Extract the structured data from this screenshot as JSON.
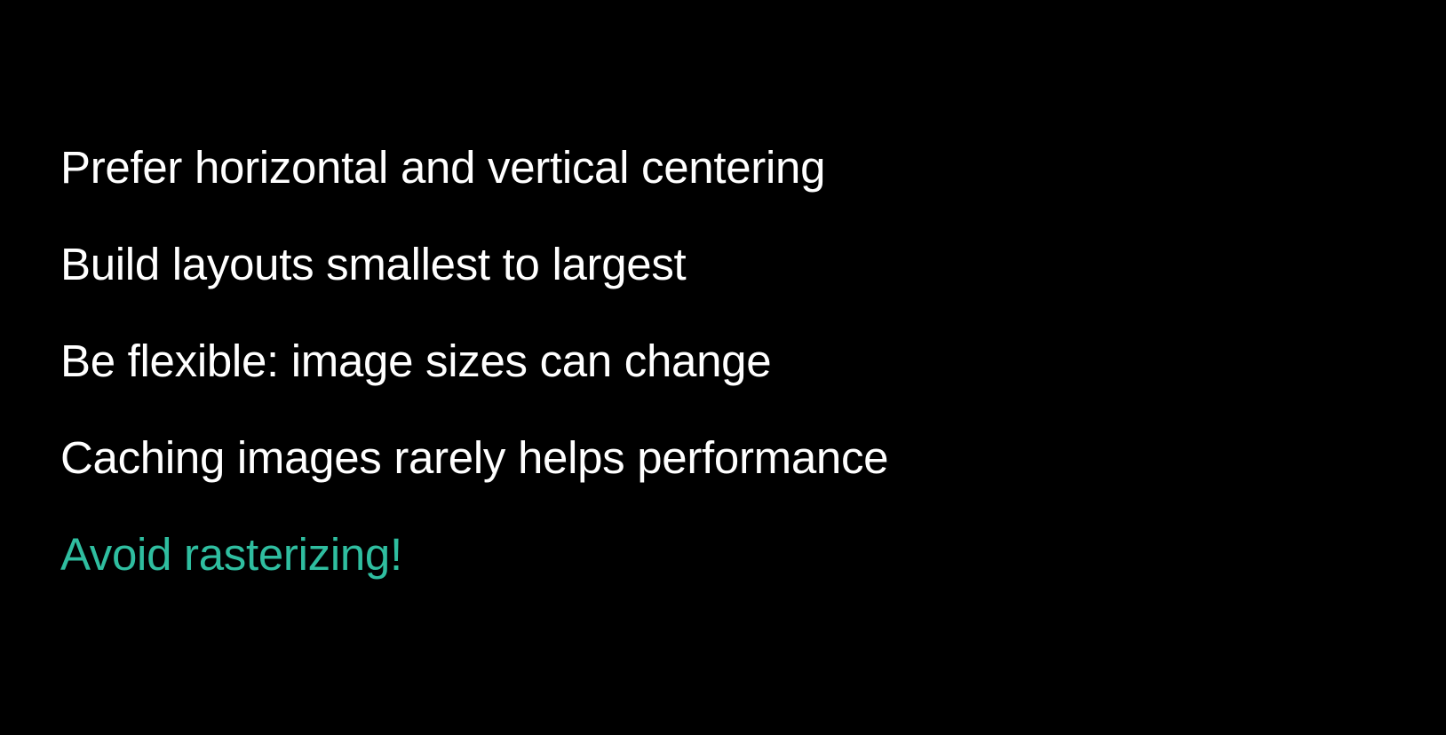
{
  "slide": {
    "bullets": [
      {
        "text": "Prefer horizontal and vertical centering"
      },
      {
        "text": "Build layouts smallest to largest"
      },
      {
        "text": "Be flexible: image sizes can change"
      },
      {
        "text": "Caching images rarely helps performance"
      },
      {
        "text": "Avoid rasterizing!"
      }
    ]
  },
  "colors": {
    "background": "#000000",
    "text": "#ffffff",
    "highlight": "#2fbea0"
  }
}
